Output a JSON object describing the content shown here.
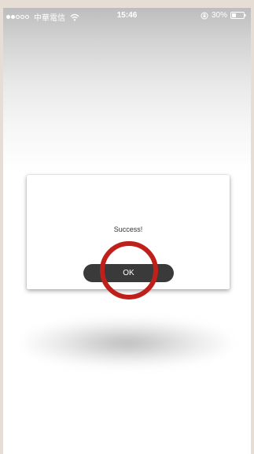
{
  "status_bar": {
    "carrier": "中華電信",
    "time": "15:46",
    "battery": "30%"
  },
  "dialog": {
    "message": "Success!",
    "ok_label": "OK"
  },
  "colors": {
    "highlight": "#c0201c",
    "button_bg": "#3a3a3a"
  }
}
